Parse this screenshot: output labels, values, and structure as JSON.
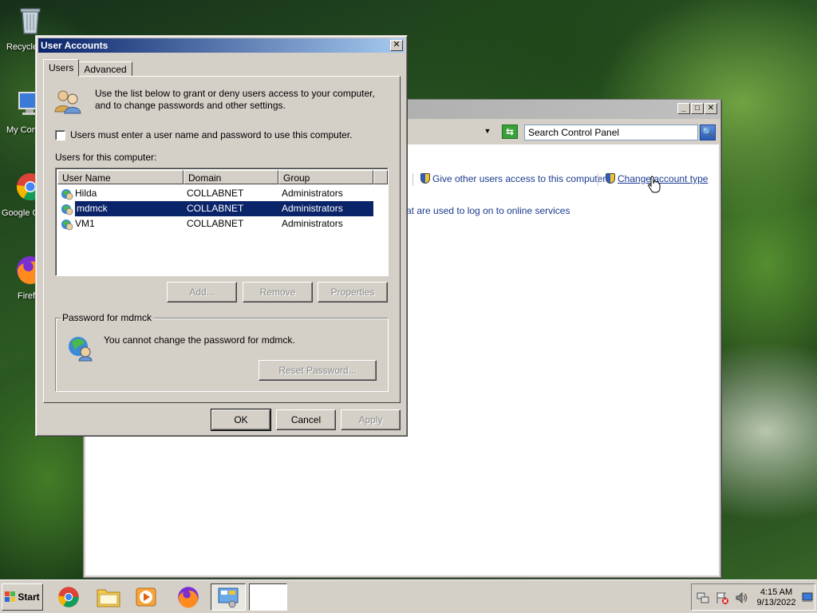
{
  "desktop": {
    "icons": [
      {
        "label": "Recycle Bin"
      },
      {
        "label": "My Computer"
      },
      {
        "label": "Google Chrome"
      },
      {
        "label": "Firefox"
      }
    ]
  },
  "control_panel": {
    "search_placeholder": "Search Control Panel",
    "tasks": {
      "give_access": "Give other users access to this computer",
      "change_type": "Change account type",
      "online_services": "at are used to log on to online services"
    }
  },
  "dialog": {
    "title": "User Accounts",
    "tabs": [
      {
        "label": "Users"
      },
      {
        "label": "Advanced"
      }
    ],
    "intro": "Use the list below to grant or deny users access to your computer, and to change passwords and other settings.",
    "require_login_label": "Users must enter a user name and password to use this computer.",
    "users_label": "Users for this computer:",
    "columns": [
      "User Name",
      "Domain",
      "Group"
    ],
    "users": [
      {
        "name": "Hilda",
        "domain": "COLLABNET",
        "group": "Administrators"
      },
      {
        "name": "mdmck",
        "domain": "COLLABNET",
        "group": "Administrators"
      },
      {
        "name": "VM1",
        "domain": "COLLABNET",
        "group": "Administrators"
      }
    ],
    "buttons": {
      "add": "Add...",
      "remove": "Remove",
      "properties": "Properties",
      "reset_password": "Reset Password...",
      "ok": "OK",
      "cancel": "Cancel",
      "apply": "Apply"
    },
    "password_group_label": "Password for mdmck",
    "password_text": "You cannot change the password for mdmck."
  },
  "taskbar": {
    "start_label": "Start",
    "time": "4:15 AM",
    "date": "9/13/2022"
  }
}
